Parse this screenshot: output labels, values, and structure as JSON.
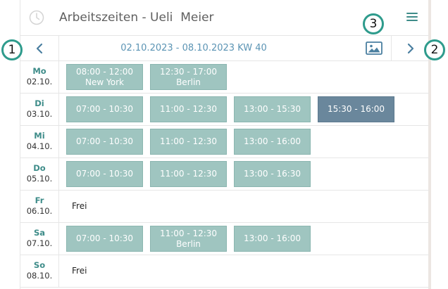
{
  "header": {
    "title": "Arbeitszeiten - Ueli  Meier",
    "icon": "clock-icon",
    "menu_icon": "hamburger-menu-icon"
  },
  "nav": {
    "week_label": "02.10.2023 - 08.10.2023 KW 40",
    "prev_icon": "chevron-left-icon",
    "next_icon": "chevron-right-icon",
    "image_icon": "image-icon"
  },
  "callouts": [
    "1",
    "2",
    "3"
  ],
  "days": [
    {
      "name": "Mo",
      "date": "02.10.",
      "slots": [
        [
          "08:00 - 12:00",
          "New York"
        ],
        [
          "12:30 - 17:00",
          "Berlin"
        ]
      ]
    },
    {
      "name": "Di",
      "date": "03.10.",
      "slots": [
        [
          "07:00 - 10:30"
        ],
        [
          "11:00 - 12:30"
        ],
        [
          "13:00 - 15:30"
        ],
        [
          "15:30 - 16:00"
        ]
      ],
      "highlight_index": 3
    },
    {
      "name": "Mi",
      "date": "04.10.",
      "slots": [
        [
          "07:00 - 10:30"
        ],
        [
          "11:00 - 12:30"
        ],
        [
          "13:00 - 16:00"
        ]
      ]
    },
    {
      "name": "Do",
      "date": "05.10.",
      "slots": [
        [
          "07:00 - 10:30"
        ],
        [
          "11:00 - 12:30"
        ],
        [
          "13:00 - 16:30"
        ]
      ]
    },
    {
      "name": "Fr",
      "date": "06.10.",
      "slots": [],
      "free": "Frei"
    },
    {
      "name": "Sa",
      "date": "07.10.",
      "slots": [
        [
          "07:00 - 10:30"
        ],
        [
          "11:00 - 12:30",
          "Berlin"
        ],
        [
          "13:00 - 16:00"
        ]
      ]
    },
    {
      "name": "So",
      "date": "08.10.",
      "slots": [],
      "free": "Frei"
    }
  ],
  "colors": {
    "accent": "#3e8c89",
    "slot": "#9fc5c0",
    "slot_highlight": "#6a879c",
    "week_label": "#5b94b4",
    "badge_border": "#2e9b8c"
  }
}
